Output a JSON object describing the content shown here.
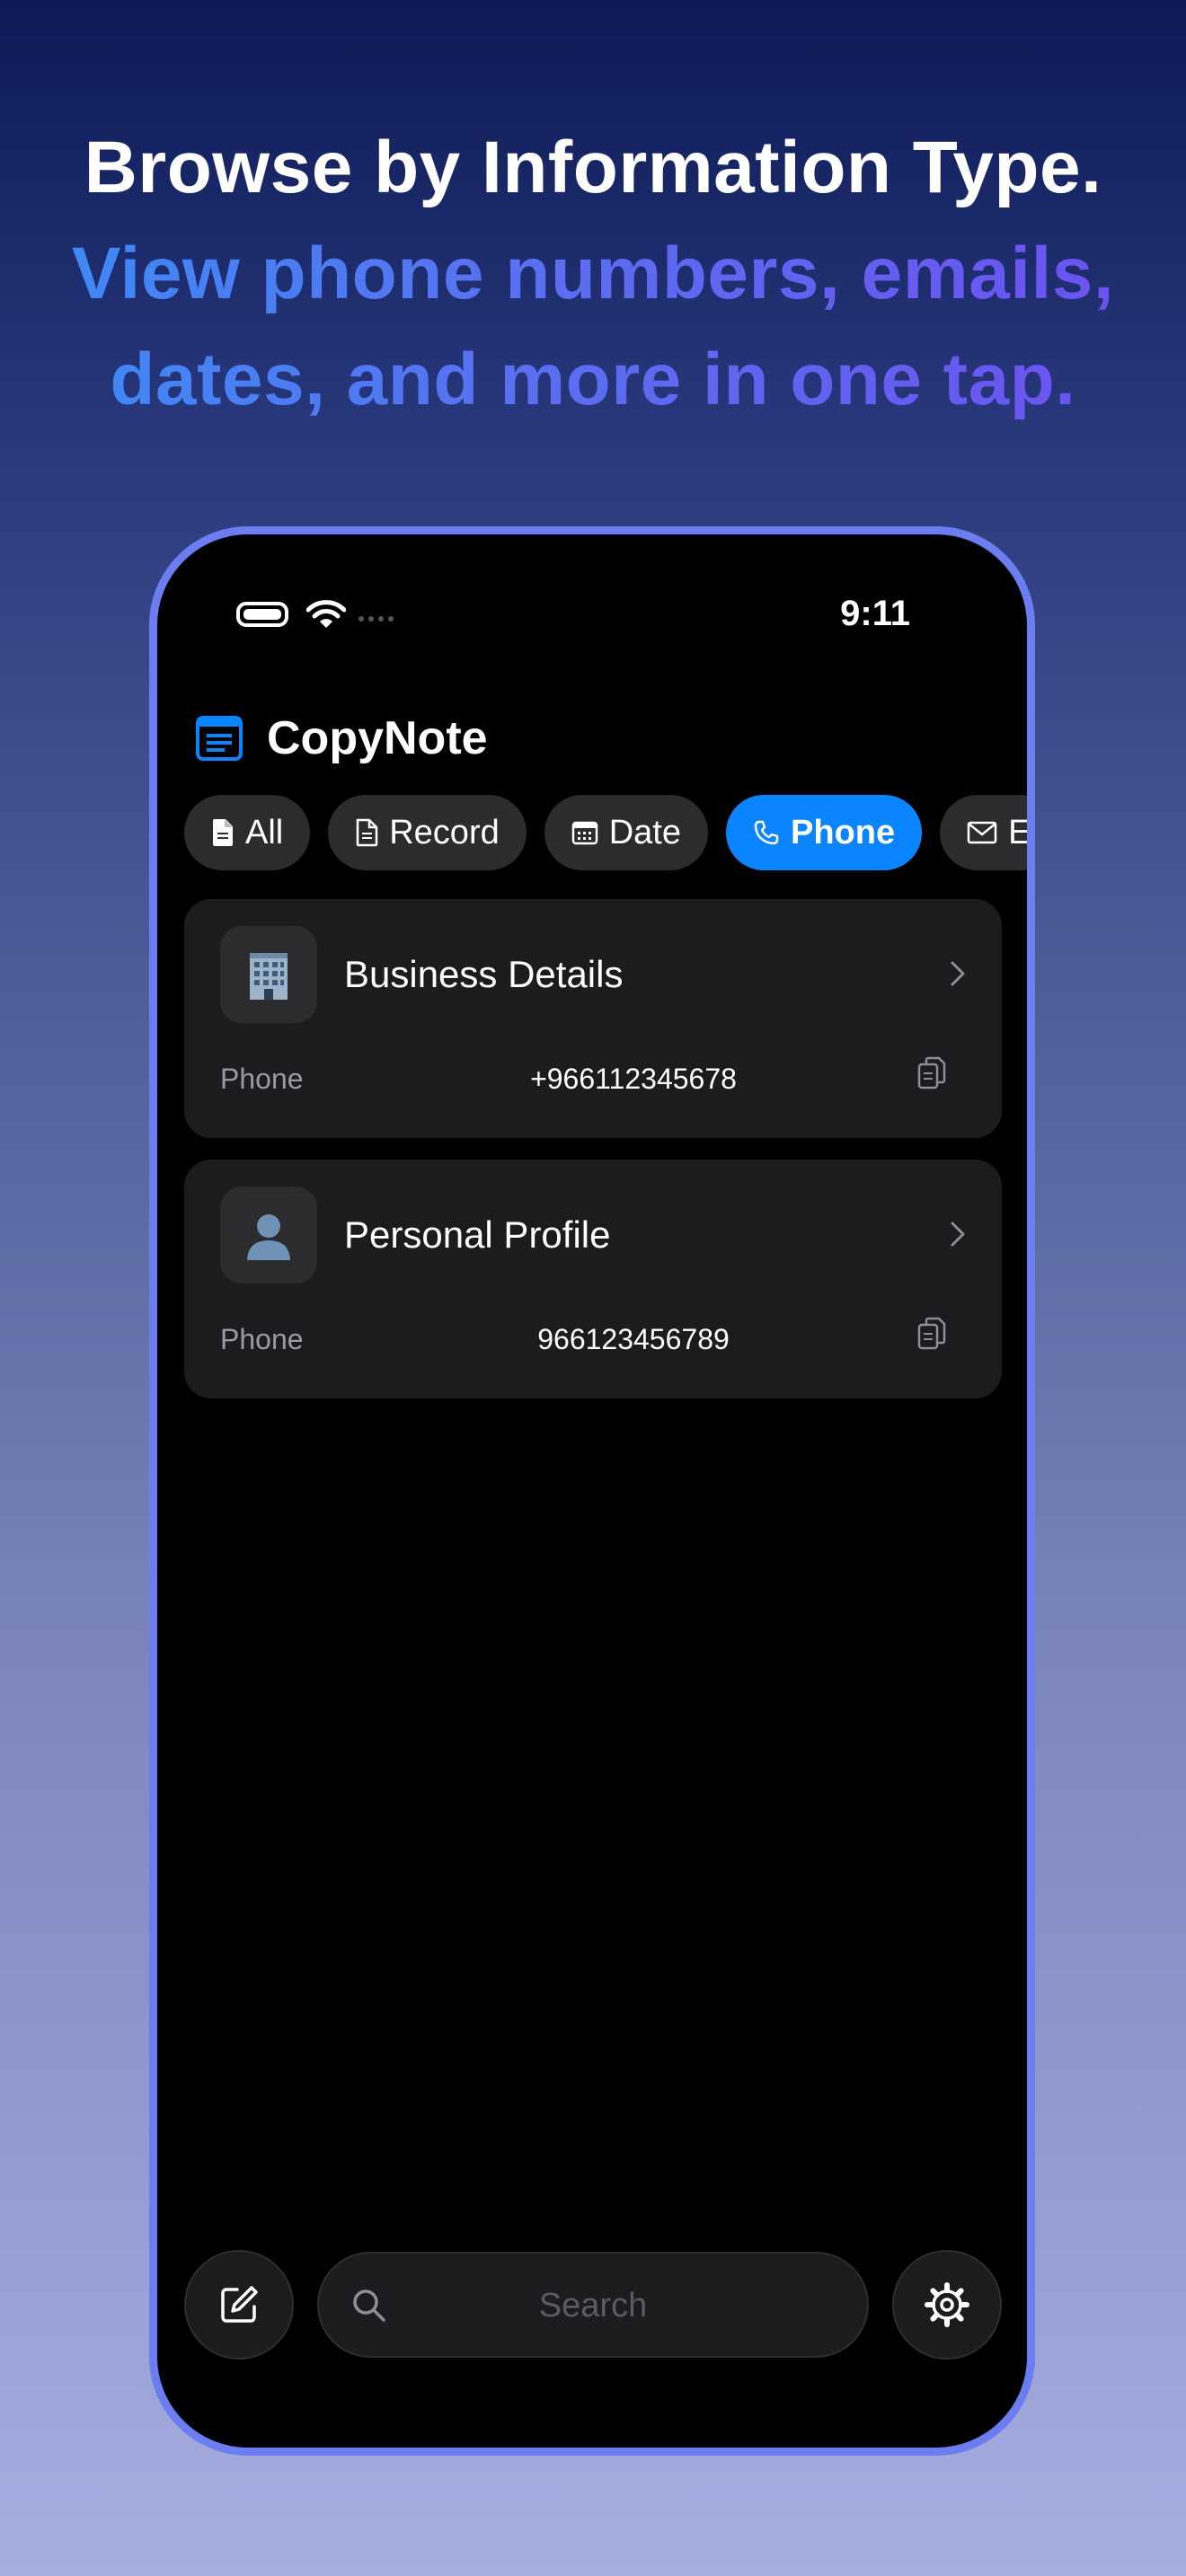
{
  "promo": {
    "headline": "Browse by Information Type.",
    "subline_1": "View phone numbers, emails,",
    "subline_2": "dates, and more in one tap."
  },
  "status_bar": {
    "time": "9:11"
  },
  "app": {
    "title": "CopyNote",
    "accent_color": "#0a84ff"
  },
  "filters": [
    {
      "label": "All",
      "icon": "document-filled-icon",
      "active": false
    },
    {
      "label": "Record",
      "icon": "document-icon",
      "active": false
    },
    {
      "label": "Date",
      "icon": "calendar-icon",
      "active": false
    },
    {
      "label": "Phone",
      "icon": "phone-icon",
      "active": true
    },
    {
      "label": "E",
      "icon": "envelope-icon",
      "active": false
    }
  ],
  "records": [
    {
      "title": "Business Details",
      "icon": "office-building-icon",
      "field_label": "Phone",
      "field_value": "+966112345678"
    },
    {
      "title": "Personal Profile",
      "icon": "person-silhouette-icon",
      "field_label": "Phone",
      "field_value": "966123456789"
    }
  ],
  "toolbar": {
    "search_placeholder": "Search"
  }
}
